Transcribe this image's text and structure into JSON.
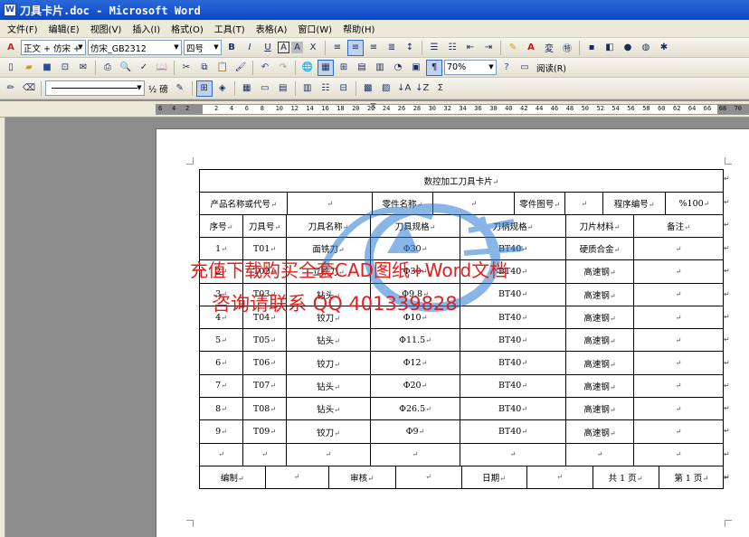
{
  "window": {
    "title": "刀具卡片.doc - Microsoft Word"
  },
  "menu": [
    "文件(F)",
    "编辑(E)",
    "视图(V)",
    "插入(I)",
    "格式(O)",
    "工具(T)",
    "表格(A)",
    "窗口(W)",
    "帮助(H)"
  ],
  "format_toolbar": {
    "style_value": "正文 + 仿宋 +",
    "font_value": "仿宋_GB2312",
    "size_value": "四号",
    "bold": "B",
    "italic": "I",
    "underline": "U"
  },
  "standard_toolbar": {
    "zoom_value": "70%",
    "read_label": "阅读(R)"
  },
  "drawing_toolbar": {
    "pen_weight_value": "½ 磅"
  },
  "ruler": {
    "left_ticks": [
      "6",
      "4",
      "2"
    ],
    "ticks": [
      "2",
      "4",
      "6",
      "8",
      "10",
      "12",
      "14",
      "16",
      "18",
      "20",
      "22",
      "24",
      "26",
      "28",
      "30",
      "32",
      "34",
      "36",
      "38",
      "40",
      "42",
      "44",
      "46",
      "48",
      "50",
      "52",
      "54",
      "56",
      "58",
      "60",
      "62",
      "64",
      "66",
      "68",
      "70"
    ]
  },
  "card": {
    "title": "数控加工刀具卡片",
    "product_label": "产品名称或代号",
    "part_name_label": "零件名称",
    "part_drawing_label": "零件图号",
    "program_label": "程序编号",
    "program_value": "%100",
    "headers": [
      "序号",
      "刀具号",
      "刀具名称",
      "刀具规格",
      "刀柄规格",
      "刀片材料",
      "备注"
    ],
    "rows": [
      [
        "1",
        "T01",
        "面铣刀",
        "Φ30",
        "BT40",
        "硬质合金",
        ""
      ],
      [
        "2",
        "T02",
        "立铣刀",
        "Φ30",
        "BT40",
        "高速钢",
        ""
      ],
      [
        "3",
        "T03",
        "钻头",
        "Φ9.8",
        "BT40",
        "高速钢",
        ""
      ],
      [
        "4",
        "T04",
        "铰刀",
        "Φ10",
        "BT40",
        "高速钢",
        ""
      ],
      [
        "5",
        "T05",
        "钻头",
        "Φ11.5",
        "BT40",
        "高速钢",
        ""
      ],
      [
        "6",
        "T06",
        "铰刀",
        "Φ12",
        "BT40",
        "高速钢",
        ""
      ],
      [
        "7",
        "T07",
        "钻头",
        "Φ20",
        "BT40",
        "高速钢",
        ""
      ],
      [
        "8",
        "T08",
        "钻头",
        "Φ26.5",
        "BT40",
        "高速钢",
        ""
      ],
      [
        "9",
        "T09",
        "铰刀",
        "Φ9",
        "BT40",
        "高速钢",
        ""
      ],
      [
        "",
        "",
        "",
        "",
        "",
        "",
        ""
      ]
    ],
    "footer": {
      "compile_label": "编制",
      "review_label": "审核",
      "date_label": "日期",
      "total_pages": "共 1 页",
      "page_no": "第 1 页"
    }
  },
  "watermark": {
    "line1": "充值下载购买全套CAD图纸+Word文档",
    "line2": "咨询请联系 QQ 401339828"
  },
  "colors": {
    "titlebar": "#0a46c8",
    "watermark": "#e0201d",
    "logo": "#2a7bd4"
  }
}
